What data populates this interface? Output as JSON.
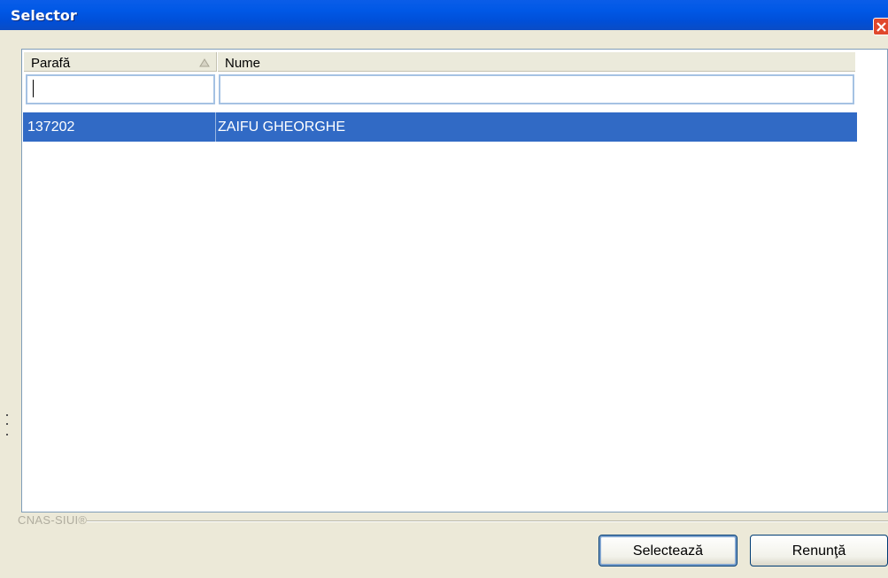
{
  "window": {
    "title": "Selector"
  },
  "table": {
    "columns": [
      "Parafă",
      "Nume"
    ],
    "filters": {
      "parafa": "",
      "nume": ""
    },
    "rows": [
      {
        "parafa": "137202",
        "nume": "ZAIFU GHEORGHE",
        "selected": true
      }
    ]
  },
  "footer": {
    "brand": "CNAS-SIUI®",
    "select_label": "Selectează",
    "cancel_label": "Renunţă"
  },
  "colors": {
    "titlebar": "#0058e6",
    "selection": "#316ac5",
    "face": "#ece9d8"
  },
  "icons": [
    "close-icon",
    "sort-ascending-icon"
  ]
}
